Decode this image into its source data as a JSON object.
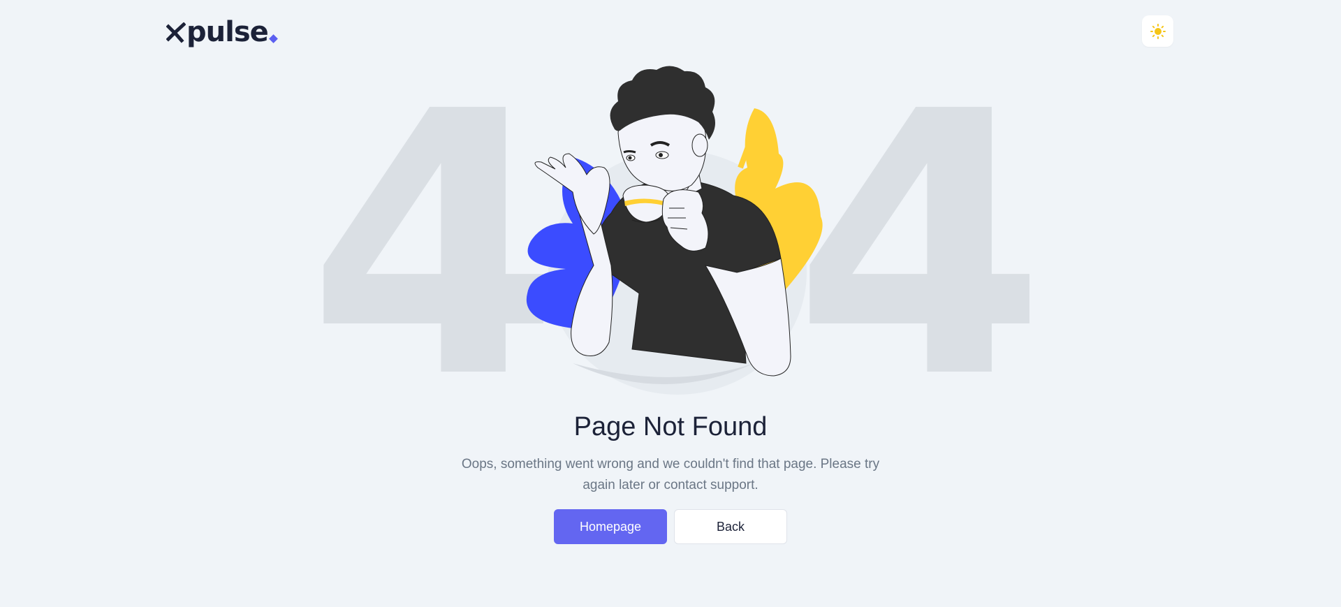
{
  "header": {
    "logo_text": "pulse",
    "logo_icon": "x-logo-mark",
    "theme_toggle_icon": "sun-icon"
  },
  "hero": {
    "digit_left": "4",
    "digit_right": "4",
    "illustration": "man-drinking-coffee-illustration"
  },
  "content": {
    "title": "Page Not Found",
    "message": "Oops, something went wrong and we couldn't find that page. Please try again later or contact support."
  },
  "actions": {
    "homepage_label": "Homepage",
    "back_label": "Back"
  },
  "colors": {
    "background": "#f0f4f8",
    "accent": "#6366f1",
    "digits": "#dadfe4",
    "blue_leaf": "#3b4cff",
    "yellow_leaf": "#ffd034",
    "shirt": "#2f2f2f"
  }
}
